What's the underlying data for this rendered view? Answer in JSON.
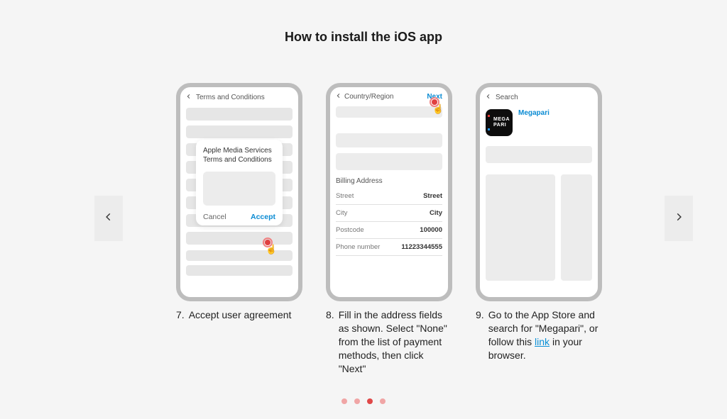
{
  "title": "How to install the iOS app",
  "steps": [
    {
      "num": "7.",
      "caption": "Accept user agreement",
      "phone1": {
        "topbar_label": "Terms and Conditions",
        "dialog_title": "Apple Media Services Terms and Conditions",
        "cancel": "Cancel",
        "accept": "Accept"
      }
    },
    {
      "num": "8.",
      "caption": "Fill in the address fields as shown. Select \"None\" from the list of payment methods, then click \"Next\"",
      "phone2": {
        "topbar_label": "Country/Region",
        "next_label": "Next",
        "section_title": "Billing Address",
        "rows": [
          {
            "label": "Street",
            "value": "Street"
          },
          {
            "label": "City",
            "value": "City"
          },
          {
            "label": "Postcode",
            "value": "100000"
          },
          {
            "label": "Phone number",
            "value": "11223344555"
          }
        ]
      }
    },
    {
      "num": "9.",
      "caption_prefix": "Go to the App Store and search for \"Megapari\", or follow this ",
      "caption_link": "link",
      "caption_suffix": " in your browser.",
      "phone3": {
        "topbar_label": "Search",
        "app_name": "Megapari",
        "app_icon_line1": "MEGA",
        "app_icon_line2": "PARI"
      }
    }
  ],
  "pagination": {
    "total": 4,
    "active_index": 2
  }
}
